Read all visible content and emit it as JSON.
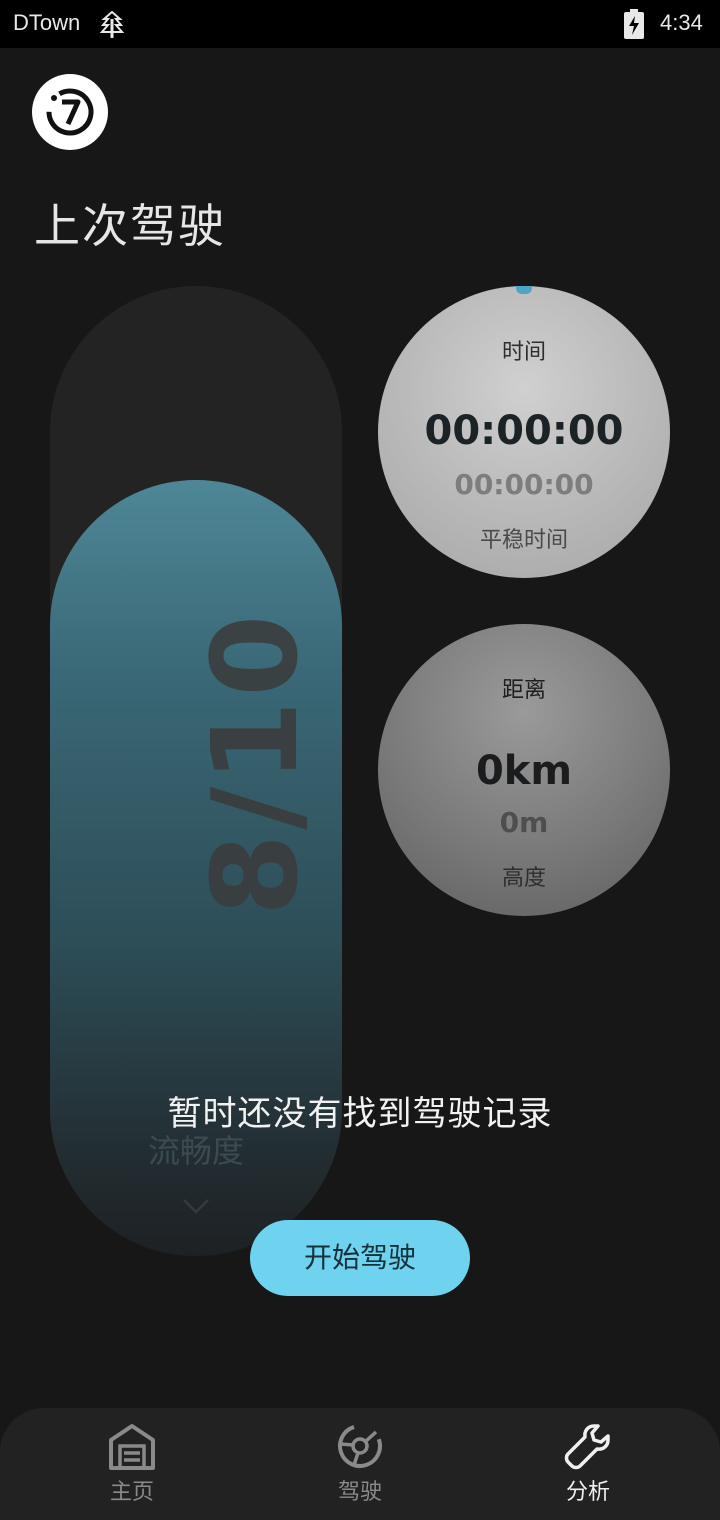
{
  "status_bar": {
    "app_name": "DTown",
    "tree_icon": "tree-icon",
    "battery_icon": "battery-charging-icon",
    "time": "4:34"
  },
  "header": {
    "logo_icon": "seven-logo-icon",
    "title": "上次驾驶"
  },
  "score": {
    "value": "8/10",
    "label": "流畅度",
    "fill_fraction": 0.8,
    "chevron_icon": "chevron-down-icon"
  },
  "time_card": {
    "label": "时间",
    "value": "00:00:00",
    "sub_value": "00:00:00",
    "sub_label": "平稳时间"
  },
  "distance_card": {
    "label": "距离",
    "value": "0km",
    "sub_value": "0m",
    "sub_label": "高度"
  },
  "empty_state": {
    "message": "暂时还没有找到驾驶记录",
    "button_label": "开始驾驶"
  },
  "nav": {
    "items": [
      {
        "label": "主页",
        "icon": "garage-icon",
        "active": false
      },
      {
        "label": "驾驶",
        "icon": "steering-wheel-icon",
        "active": false
      },
      {
        "label": "分析",
        "icon": "wrench-icon",
        "active": true
      }
    ]
  },
  "colors": {
    "background": "#171717",
    "accent": "#6fd2ef",
    "score_fill": "#4e8797",
    "nav_bg": "#222222"
  }
}
